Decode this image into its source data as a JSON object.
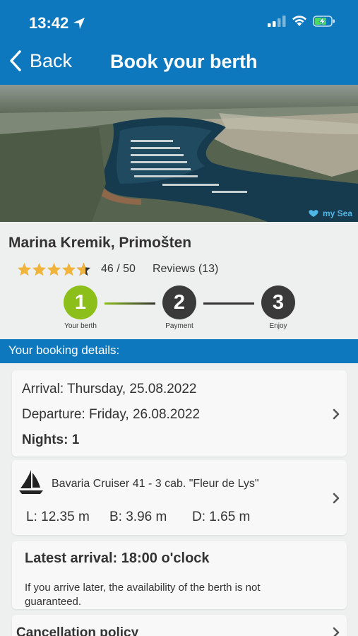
{
  "status_bar": {
    "time": "13:42"
  },
  "nav": {
    "back_label": "Back",
    "title": "Book your berth"
  },
  "hero": {
    "logo_text": "my Sea"
  },
  "marina": {
    "name": "Marina Kremik, Primošten",
    "rating": 4.6,
    "rating_text": "46 / 50",
    "reviews_text": "Reviews (13)"
  },
  "steps": [
    {
      "number": "1",
      "label": "Your berth",
      "active": true
    },
    {
      "number": "2",
      "label": "Payment",
      "active": false
    },
    {
      "number": "3",
      "label": "Enjoy",
      "active": false
    }
  ],
  "booking": {
    "section_title": "Your booking details:",
    "arrival": "Arrival: Thursday, 25.08.2022",
    "departure": "Departure: Friday, 26.08.2022",
    "nights": "Nights: 1",
    "boat_name": "Bavaria Cruiser 41 - 3 cab. \"Fleur de Lys\"",
    "length": "L: 12.35 m",
    "beam": "B: 3.96 m",
    "draft": "D: 1.65 m",
    "latest_arrival": "Latest arrival: 18:00 o'clock",
    "latest_note": "If you arrive later, the availability of the berth is not guaranteed.",
    "cancellation": "Cancellation policy"
  },
  "colors": {
    "brand_blue": "#0d78be",
    "step_active": "#8dbf1a",
    "step_inactive": "#3a3a3a",
    "star": "#f0b43c"
  }
}
